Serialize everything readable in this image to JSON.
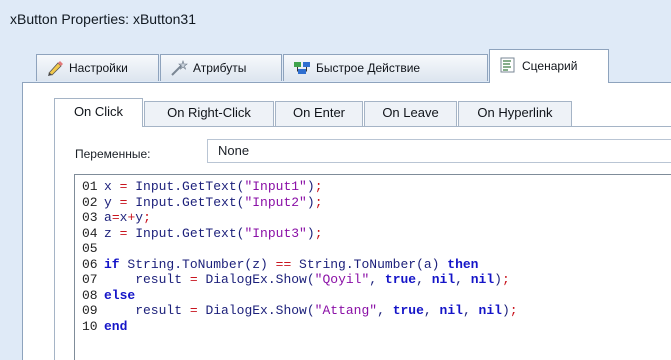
{
  "window": {
    "title": "xButton Properties: xButton31"
  },
  "tabs": [
    {
      "label": "Настройки",
      "icon": "pencil-icon",
      "active": false
    },
    {
      "label": "Атрибуты",
      "icon": "wand-icon",
      "active": false
    },
    {
      "label": "Быстрое Действие",
      "icon": "flow-icon",
      "active": false
    },
    {
      "label": "Сценарий",
      "icon": "script-icon",
      "active": true
    }
  ],
  "subtabs": [
    {
      "label": "On Click",
      "active": true
    },
    {
      "label": "On Right-Click",
      "active": false
    },
    {
      "label": "On Enter",
      "active": false
    },
    {
      "label": "On Leave",
      "active": false
    },
    {
      "label": "On Hyperlink",
      "active": false
    }
  ],
  "variables": {
    "label": "Переменные:",
    "value": "None"
  },
  "code_lines": [
    {
      "num": "01",
      "text": "x = Input.GetText(\"Input1\");"
    },
    {
      "num": "02",
      "text": "y = Input.GetText(\"Input2\");"
    },
    {
      "num": "03",
      "text": "a=x+y;"
    },
    {
      "num": "04",
      "text": "z = Input.GetText(\"Input3\");"
    },
    {
      "num": "05",
      "text": ""
    },
    {
      "num": "06",
      "text": "if String.ToNumber(z) == String.ToNumber(a) then"
    },
    {
      "num": "07",
      "text": "    result = DialogEx.Show(\"Qoyil\", true, nil, nil);"
    },
    {
      "num": "08",
      "text": "else"
    },
    {
      "num": "09",
      "text": "    result = DialogEx.Show(\"Attang\", true, nil, nil);"
    },
    {
      "num": "10",
      "text": "end"
    }
  ],
  "colors": {
    "keyword": "#1414c8",
    "string": "#8a0fa6",
    "operator": "#c8141e",
    "identifier": "#1b1f7a",
    "window_bg": "#dfeaf7"
  }
}
